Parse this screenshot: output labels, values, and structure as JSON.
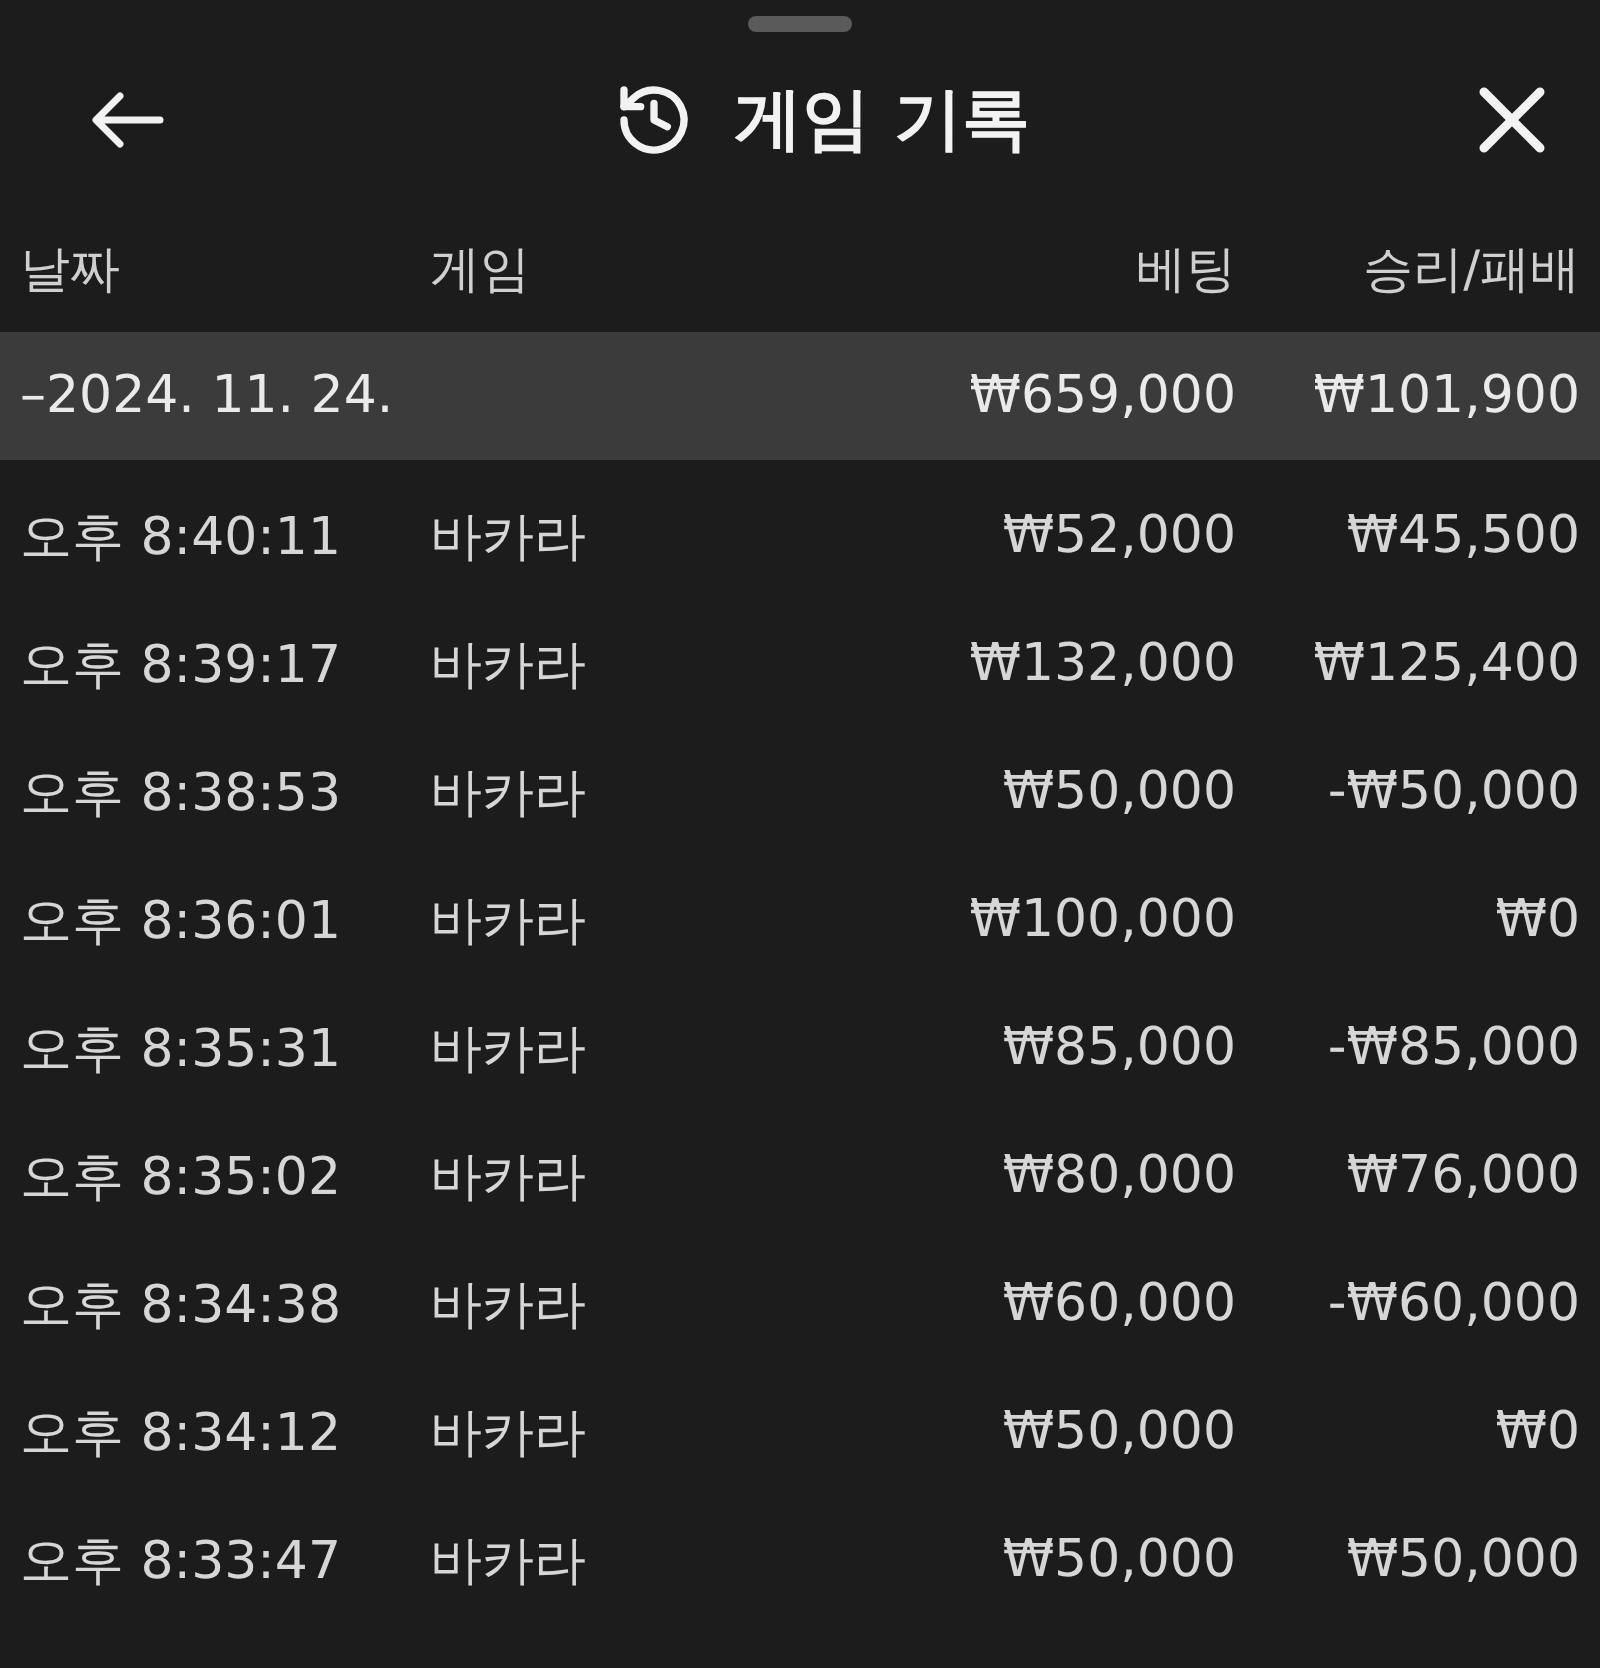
{
  "header": {
    "title": "게임 기록"
  },
  "columns": [
    "날짜",
    "게임",
    "베팅",
    "승리/패배"
  ],
  "group": {
    "date": "–2024. 11. 24.",
    "bet": "₩659,000",
    "result": "₩101,900"
  },
  "rows": [
    {
      "time": "오후 8:40:11",
      "game": "바카라",
      "bet": "₩52,000",
      "result": "₩45,500"
    },
    {
      "time": "오후 8:39:17",
      "game": "바카라",
      "bet": "₩132,000",
      "result": "₩125,400"
    },
    {
      "time": "오후 8:38:53",
      "game": "바카라",
      "bet": "₩50,000",
      "result": "-₩50,000"
    },
    {
      "time": "오후 8:36:01",
      "game": "바카라",
      "bet": "₩100,000",
      "result": "₩0"
    },
    {
      "time": "오후 8:35:31",
      "game": "바카라",
      "bet": "₩85,000",
      "result": "-₩85,000"
    },
    {
      "time": "오후 8:35:02",
      "game": "바카라",
      "bet": "₩80,000",
      "result": "₩76,000"
    },
    {
      "time": "오후 8:34:38",
      "game": "바카라",
      "bet": "₩60,000",
      "result": "-₩60,000"
    },
    {
      "time": "오후 8:34:12",
      "game": "바카라",
      "bet": "₩50,000",
      "result": "₩0"
    },
    {
      "time": "오후 8:33:47",
      "game": "바카라",
      "bet": "₩50,000",
      "result": "₩50,000"
    }
  ]
}
